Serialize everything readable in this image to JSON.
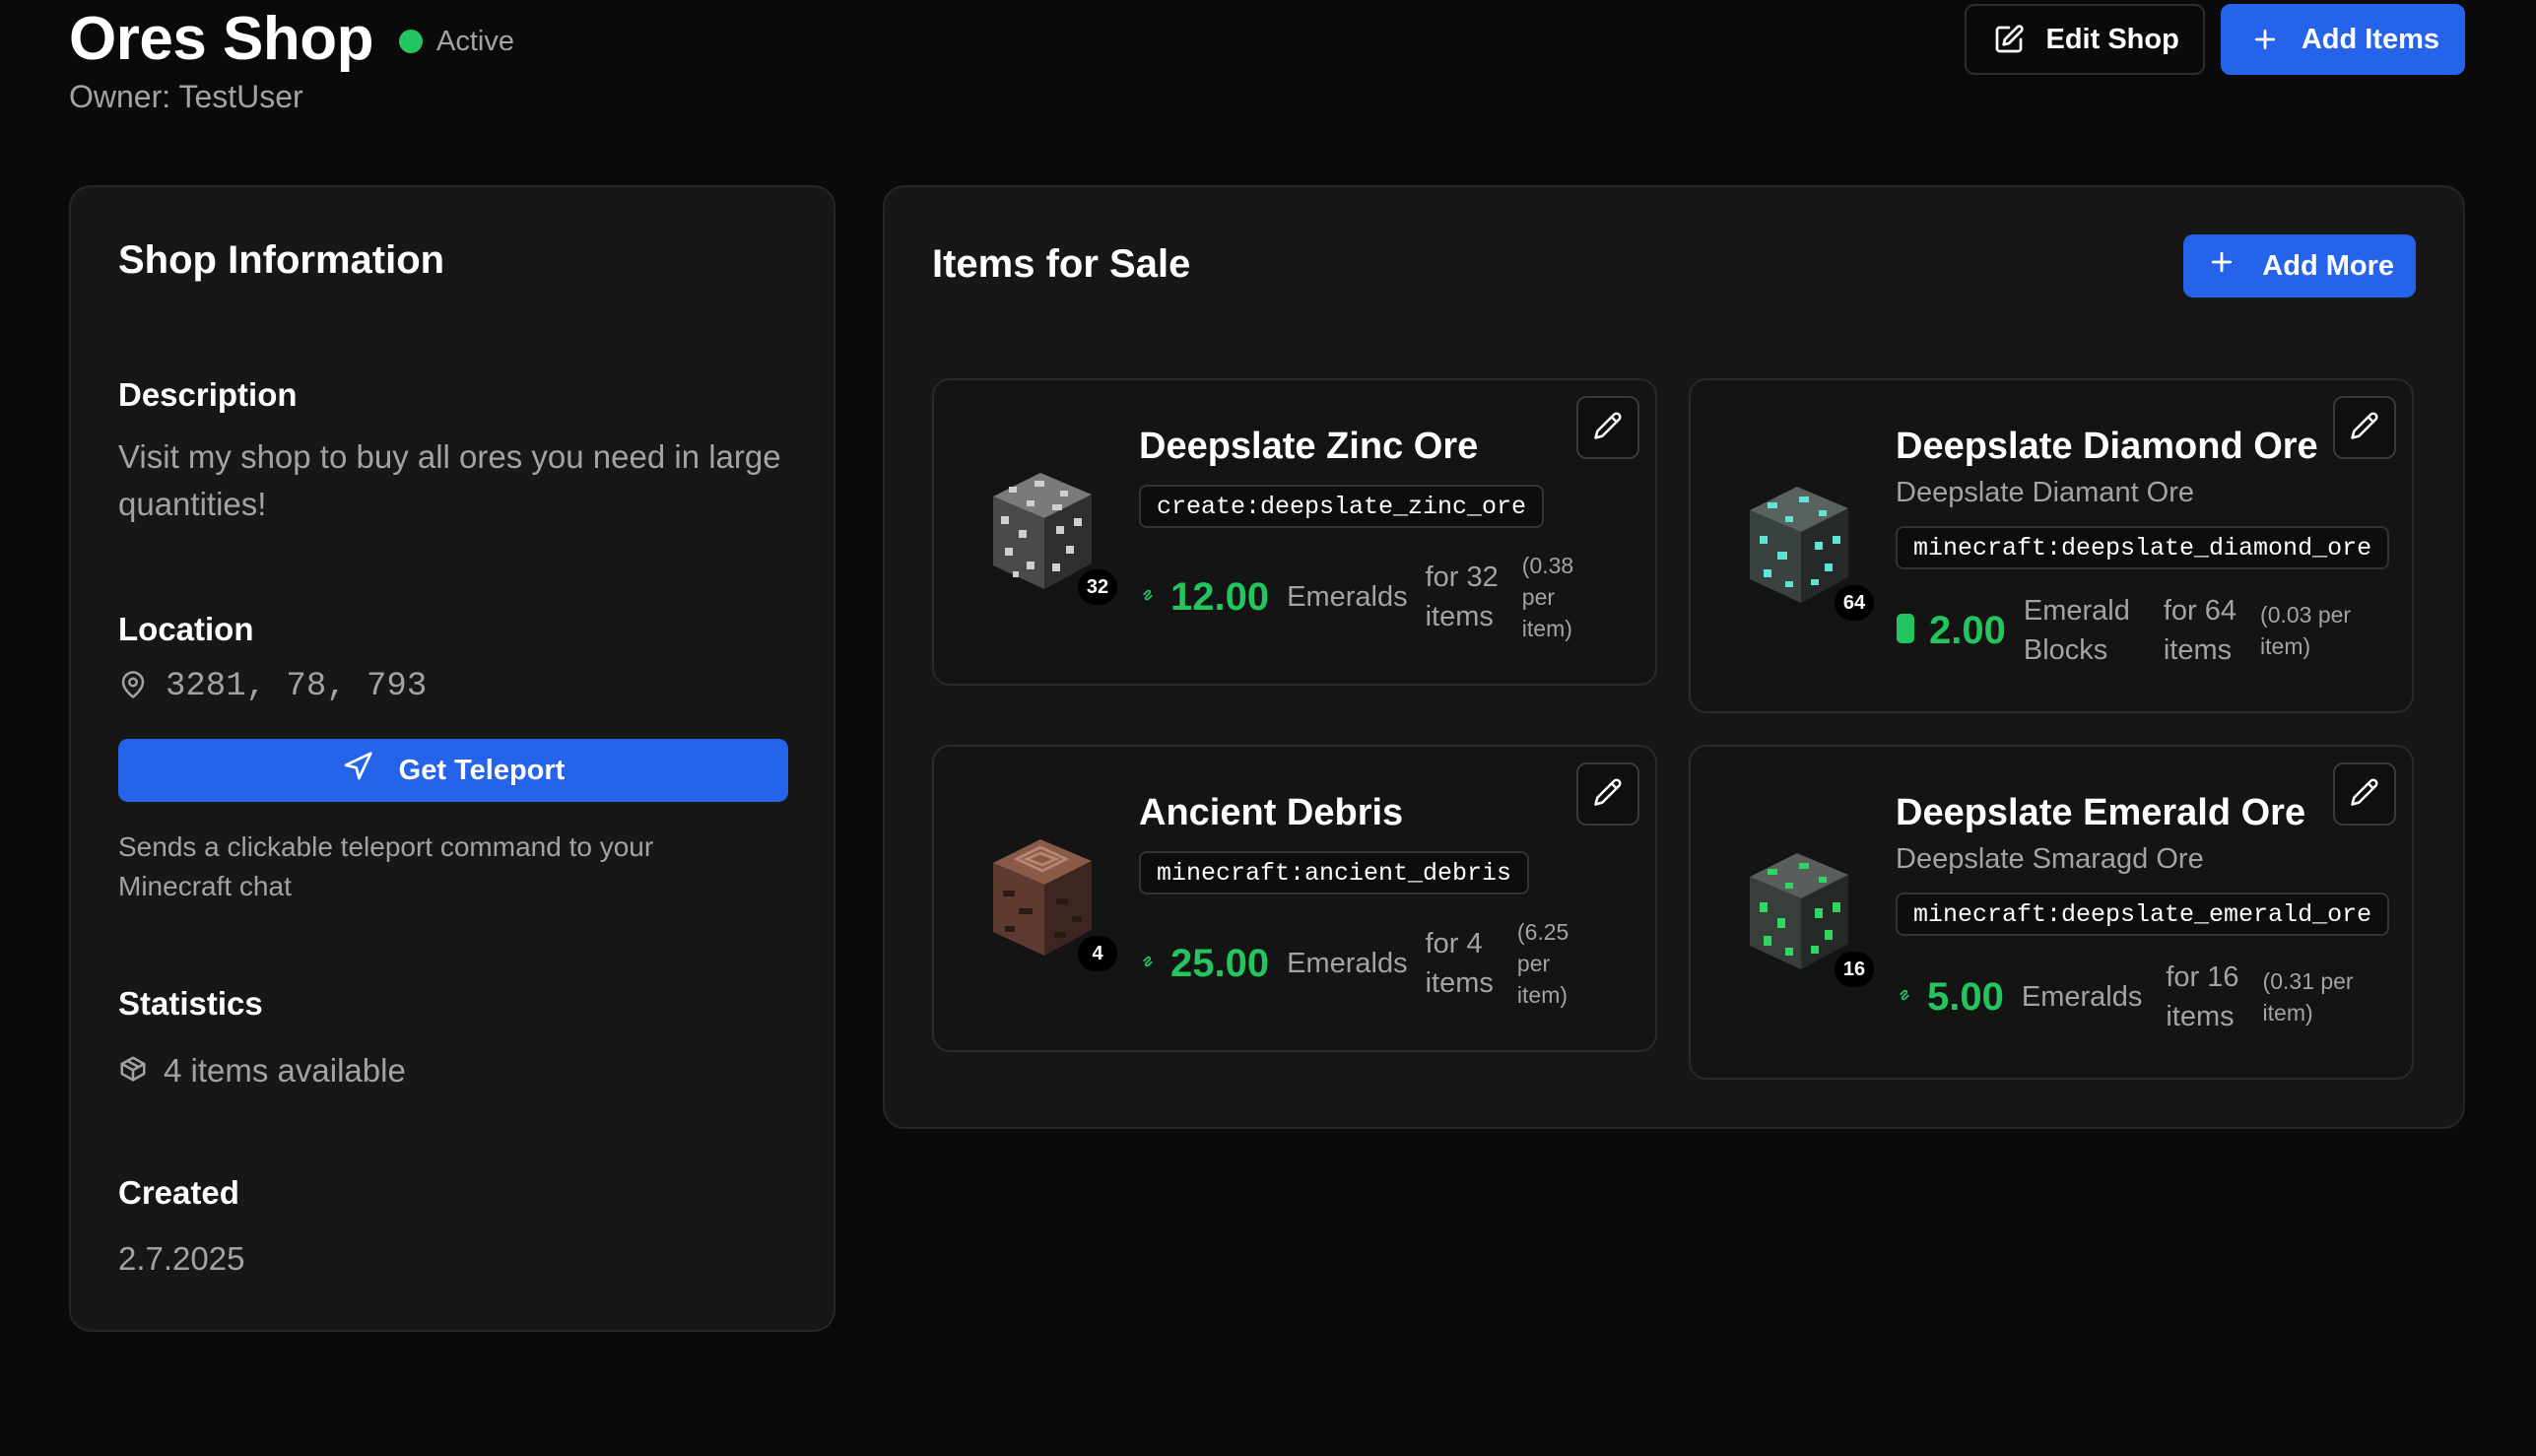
{
  "header": {
    "title": "Ores Shop",
    "status": "Active",
    "owner": "Owner: TestUser",
    "edit_label": "Edit Shop",
    "add_label": "Add Items"
  },
  "info": {
    "title": "Shop Information",
    "description_label": "Description",
    "description_line1": "Visit my shop to buy all ores you need in large",
    "description_line2": "quantities!",
    "location_label": "Location",
    "coords": "3281, 78, 793",
    "teleport_label": "Get Teleport",
    "teleport_note_line1": "Sends a clickable teleport command to your",
    "teleport_note_line2": "Minecraft chat",
    "statistics_label": "Statistics",
    "items_available": "4 items available",
    "created_label": "Created",
    "created_value": "2.7.2025"
  },
  "sale": {
    "title": "Items for Sale",
    "add_more_label": "Add More",
    "items": [
      {
        "name": "Deepslate Zinc Ore",
        "alt_name": "",
        "id": "create:deepslate_zinc_ore",
        "qty": "32",
        "price": "12.00",
        "currency_l1": "Emeralds",
        "currency_l2": "",
        "for_l1": "for 32",
        "for_l2": "items",
        "per_l1": "(0.38",
        "per_l2": "per",
        "per_l3": "item)",
        "currency_icon": "emerald-icon"
      },
      {
        "name": "Deepslate Diamond Ore",
        "alt_name": "Deepslate Diamant Ore",
        "id": "minecraft:deepslate_diamond_ore",
        "qty": "64",
        "price": "2.00",
        "currency_l1": "Emerald",
        "currency_l2": "Blocks",
        "for_l1": "for 64",
        "for_l2": "items",
        "per_l1": "(0.03 per",
        "per_l2": "item)",
        "per_l3": "",
        "currency_icon": "emerald-block-icon"
      },
      {
        "name": "Ancient Debris",
        "alt_name": "",
        "id": "minecraft:ancient_debris",
        "qty": "4",
        "price": "25.00",
        "currency_l1": "Emeralds",
        "currency_l2": "",
        "for_l1": "for 4",
        "for_l2": "items",
        "per_l1": "(6.25",
        "per_l2": "per",
        "per_l3": "item)",
        "currency_icon": "emerald-icon"
      },
      {
        "name": "Deepslate Emerald Ore",
        "alt_name": "Deepslate Smaragd Ore",
        "id": "minecraft:deepslate_emerald_ore",
        "qty": "16",
        "price": "5.00",
        "currency_l1": "Emeralds",
        "currency_l2": "",
        "for_l1": "for 16",
        "for_l2": "items",
        "per_l1": "(0.31 per",
        "per_l2": "item)",
        "per_l3": "",
        "currency_icon": "emerald-icon"
      }
    ]
  },
  "colors": {
    "accent": "#2563eb",
    "status": "#22c55e",
    "price": "#22c55e",
    "background": "#0a0a0a",
    "card": "#171717"
  }
}
